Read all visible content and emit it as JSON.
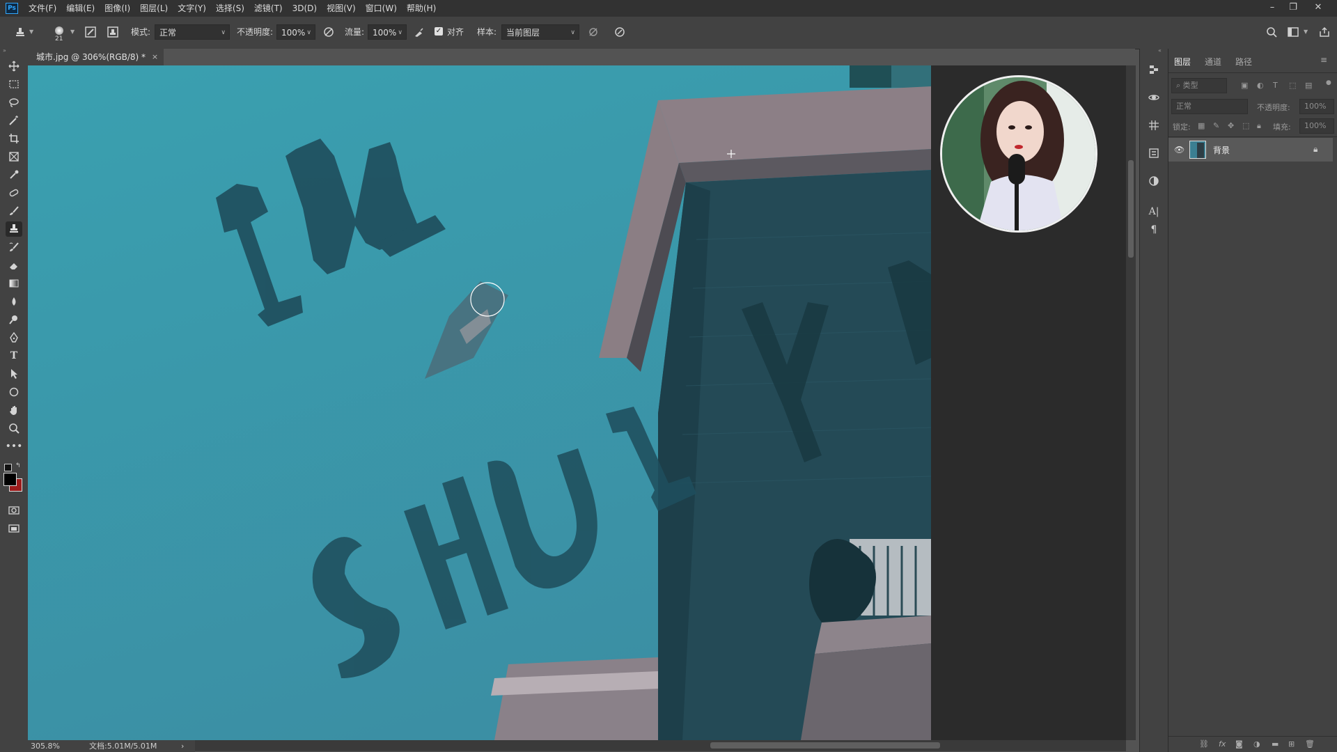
{
  "menu": {
    "logo": "Ps",
    "items": [
      "文件(F)",
      "编辑(E)",
      "图像(I)",
      "图层(L)",
      "文字(Y)",
      "选择(S)",
      "滤镜(T)",
      "3D(D)",
      "视图(V)",
      "窗口(W)",
      "帮助(H)"
    ]
  },
  "options": {
    "brush_size": "21",
    "mode_label": "模式:",
    "mode_value": "正常",
    "opacity_label": "不透明度:",
    "opacity_value": "100%",
    "flow_label": "流量:",
    "flow_value": "100%",
    "aligned_label": "对齐",
    "aligned_checked": true,
    "sample_label": "样本:",
    "sample_value": "当前图层"
  },
  "document": {
    "tab_title": "城市.jpg @ 306%(RGB/8) *",
    "tab_close": "×"
  },
  "status": {
    "zoom": "305.8%",
    "doc_size": "文档:5.01M/5.01M",
    "arrow": "›"
  },
  "canvas_text": {
    "word_in": "IN",
    "word_shu": "SHUI",
    "word_right": "YU"
  },
  "layers_panel": {
    "tabs": [
      "图层",
      "通道",
      "路径"
    ],
    "filter_placeholder": "类型",
    "blend_mode": "正常",
    "opacity_label": "不透明度:",
    "opacity_value": "100%",
    "lock_label": "锁定:",
    "fill_label": "填充:",
    "fill_value": "100%",
    "layers": [
      {
        "name": "背景",
        "visible": true,
        "locked": true
      }
    ]
  },
  "colors": {
    "sky": "#3a9cab",
    "letters": "#1f4f5d",
    "foreground": "#000000",
    "background": "#9c1c1c"
  },
  "icons": {
    "toolbar": [
      "move-icon",
      "marquee-icon",
      "lasso-icon",
      "magic-wand-icon",
      "crop-icon",
      "frame-icon",
      "eyedropper-icon",
      "healing-icon",
      "brush-icon",
      "clone-stamp-icon",
      "history-brush-icon",
      "eraser-icon",
      "gradient-icon",
      "blur-icon",
      "dodge-icon",
      "pen-icon",
      "type-icon",
      "path-select-icon",
      "shape-icon",
      "hand-icon",
      "zoom-icon",
      "more-icon"
    ]
  }
}
